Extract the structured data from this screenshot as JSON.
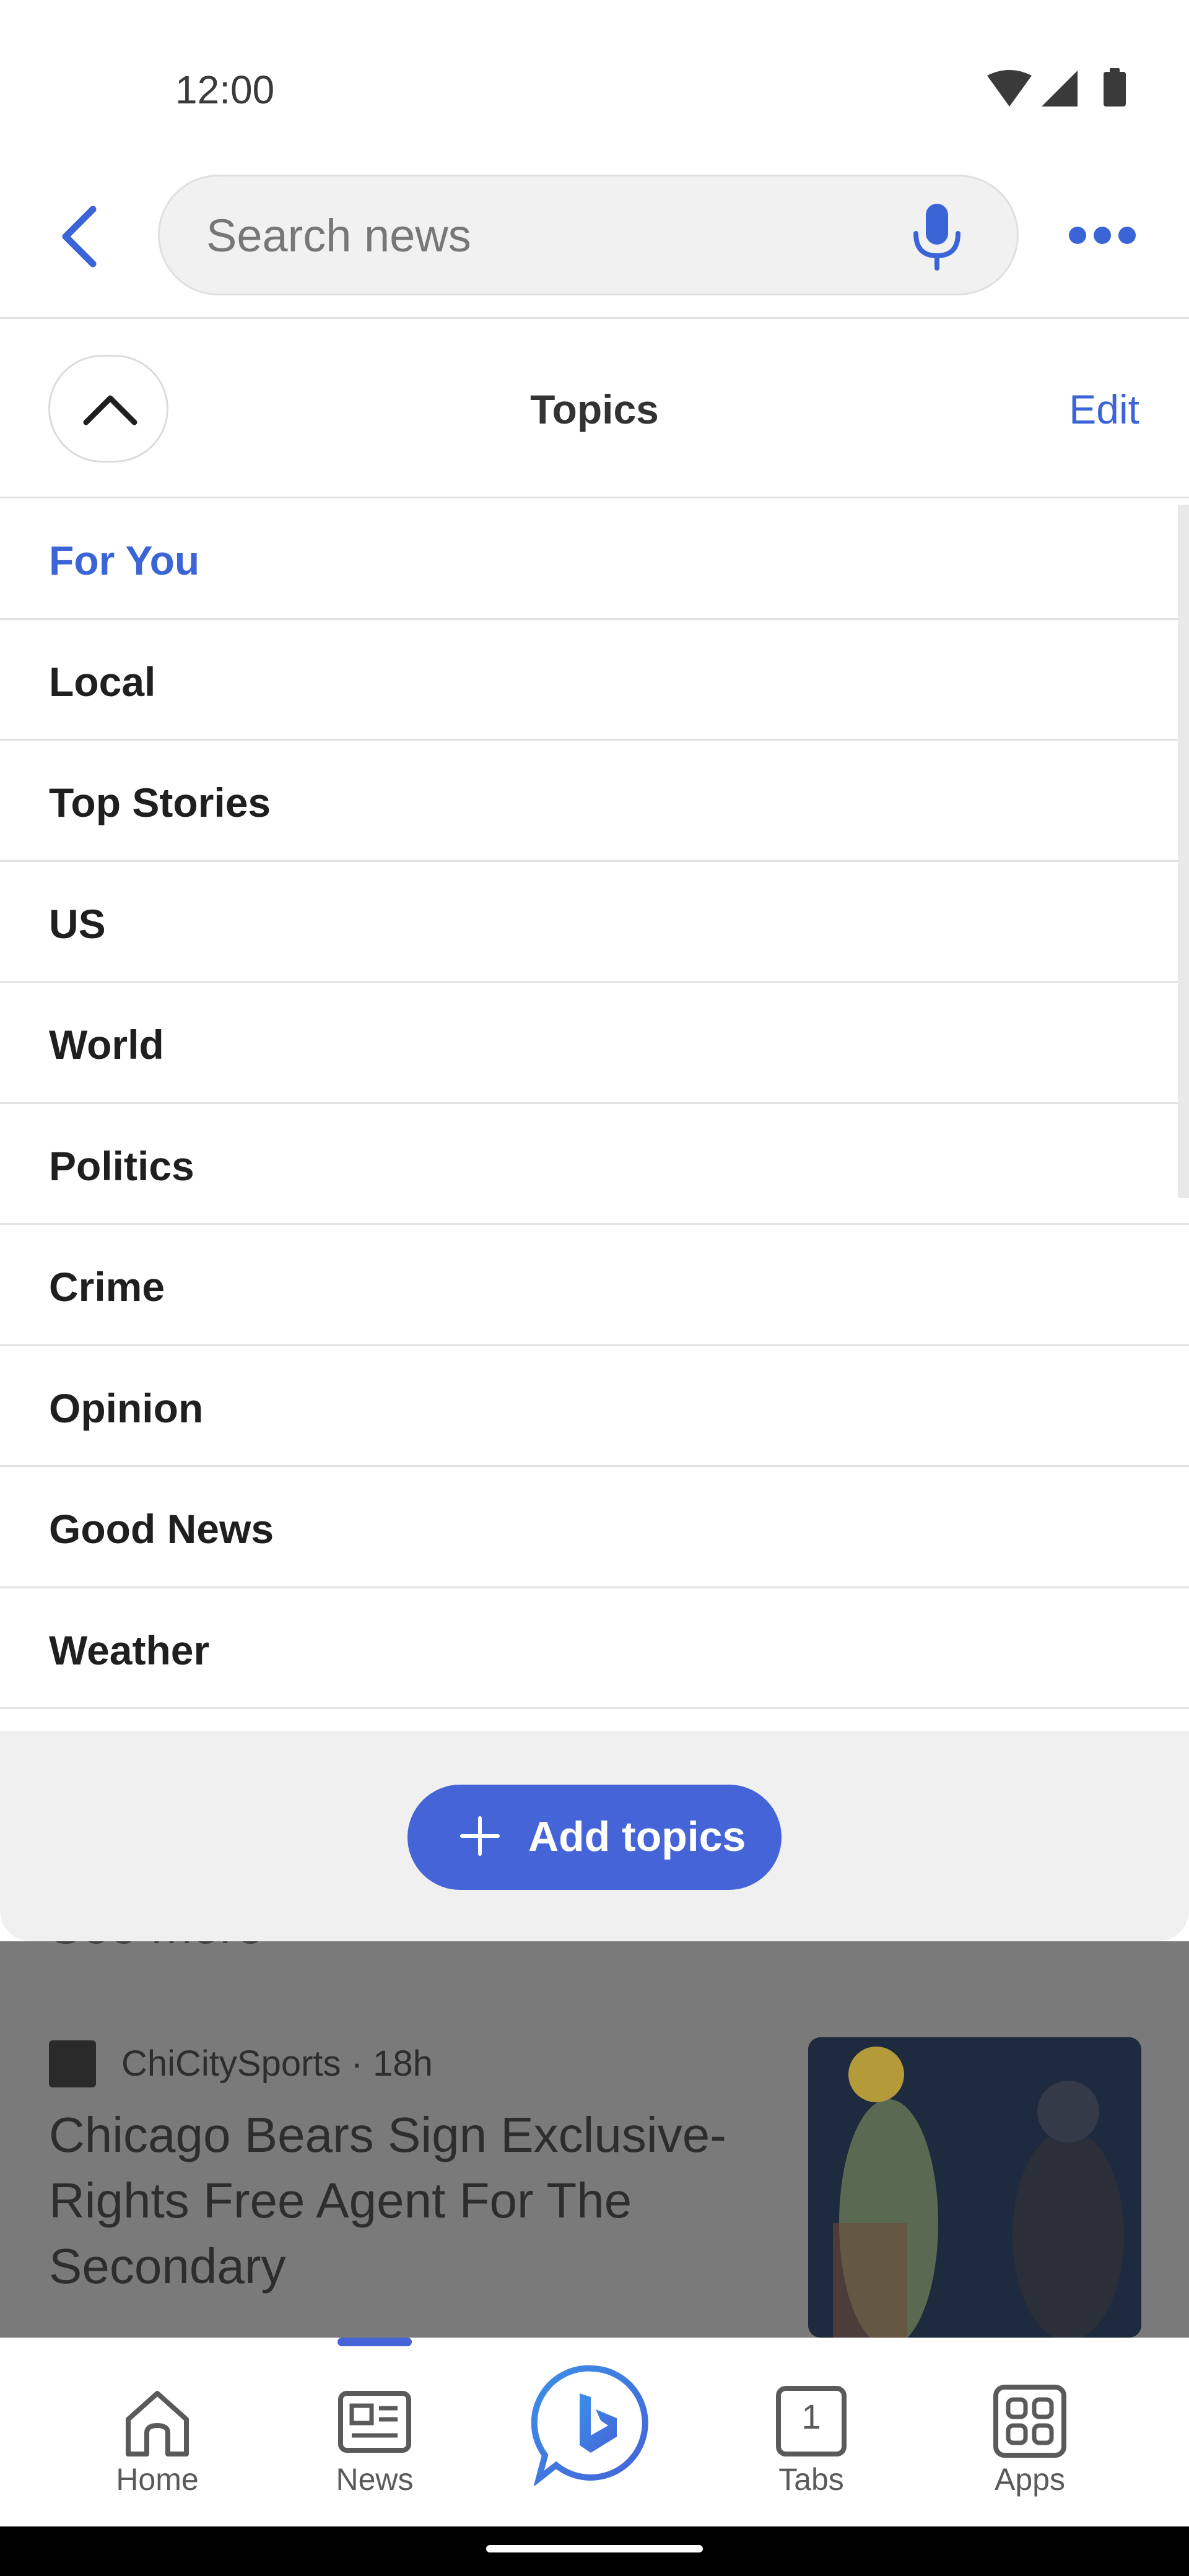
{
  "status_bar": {
    "time": "12:00",
    "icons": [
      "wifi-icon",
      "cellular-signal-icon",
      "battery-icon"
    ]
  },
  "header": {
    "search_placeholder": "Search news",
    "icons": {
      "back": "chevron-left-icon",
      "mic": "microphone-icon",
      "more": "more-horizontal-icon"
    }
  },
  "topics": {
    "title": "Topics",
    "edit_label": "Edit",
    "items": [
      {
        "label": "For You",
        "active": true
      },
      {
        "label": "Local",
        "active": false
      },
      {
        "label": "Top Stories",
        "active": false
      },
      {
        "label": "US",
        "active": false
      },
      {
        "label": "World",
        "active": false
      },
      {
        "label": "Politics",
        "active": false
      },
      {
        "label": "Crime",
        "active": false
      },
      {
        "label": "Opinion",
        "active": false
      },
      {
        "label": "Good News",
        "active": false
      },
      {
        "label": "Weather",
        "active": false
      }
    ],
    "add_label": "Add topics"
  },
  "feed": {
    "see_more": "See more",
    "article": {
      "source": "ChiCitySports · 18h",
      "title": "Chicago Bears Sign Exclusive-Rights Free Agent For The Secondary"
    }
  },
  "bottom_nav": {
    "items": [
      {
        "label": "Home",
        "icon": "home-icon"
      },
      {
        "label": "News",
        "icon": "newspaper-icon",
        "selected": true
      },
      {
        "label": "Tabs",
        "icon": "tabs-icon",
        "count": "1"
      },
      {
        "label": "Apps",
        "icon": "apps-grid-icon"
      }
    ],
    "center_icon": "bing-chat-icon"
  },
  "colors": {
    "accent": "#4564d8",
    "link": "#3b64d6",
    "text": "#1f1f1f",
    "divider": "#e2e2e2"
  }
}
